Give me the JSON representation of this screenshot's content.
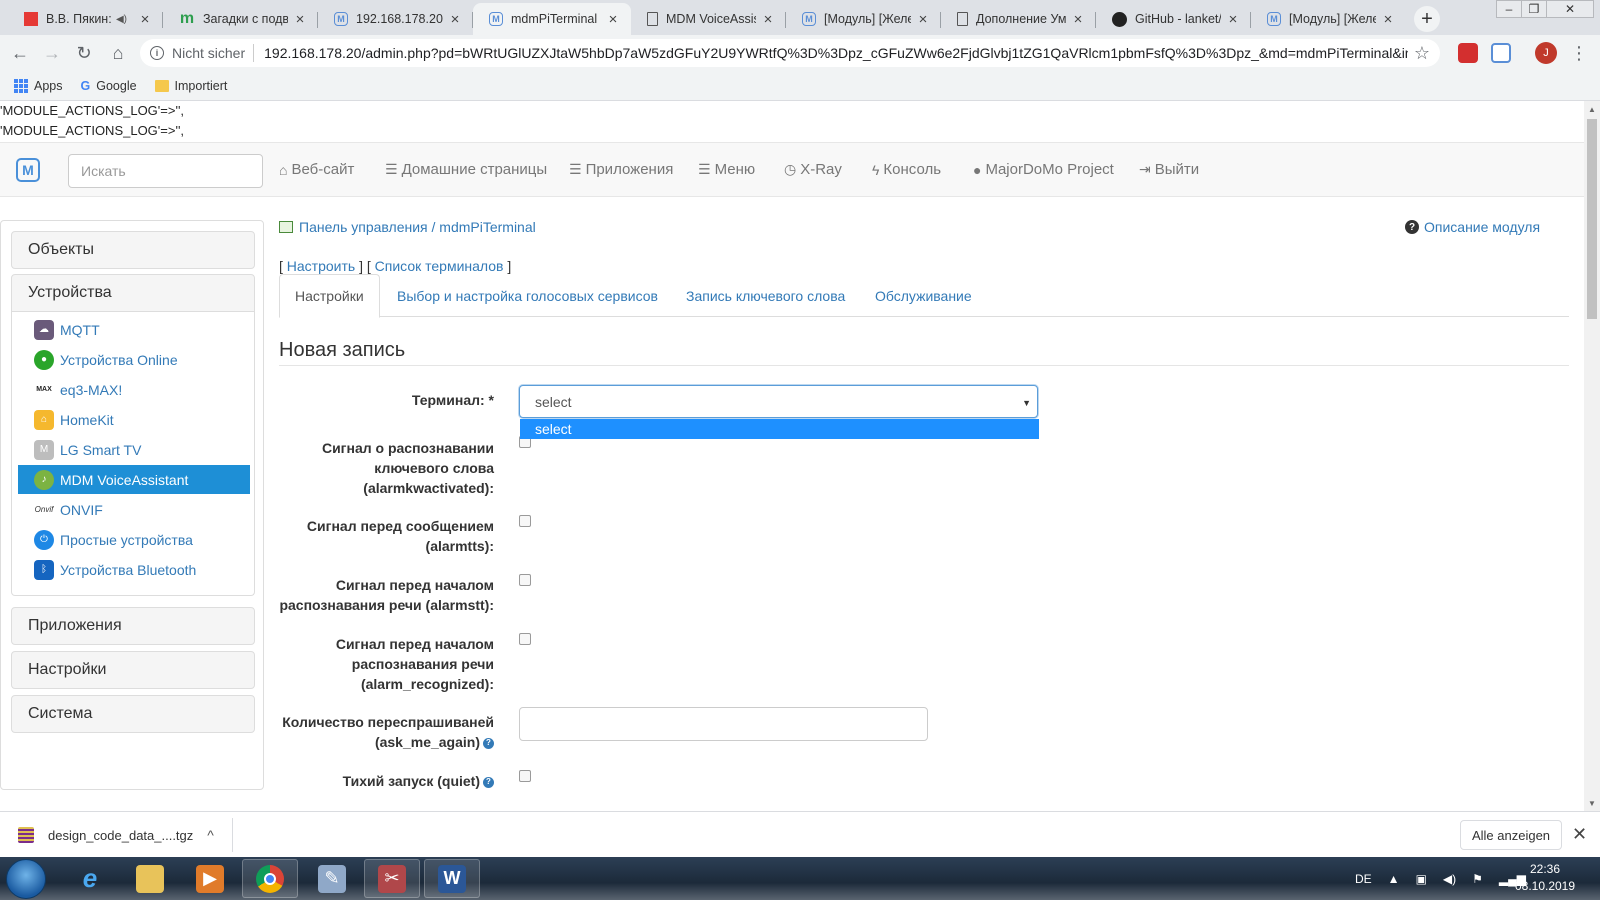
{
  "browser": {
    "tabs": [
      {
        "title": "В.В. Пякин: В",
        "icon": "red-square-icon"
      },
      {
        "title": "Загадки с подво",
        "icon": "mi-icon"
      },
      {
        "title": "192.168.178.20",
        "icon": "majordomo-icon"
      },
      {
        "title": "mdmPiTerminal",
        "icon": "majordomo-icon",
        "active": true
      },
      {
        "title": "MDM VoiceAssis",
        "icon": "document-icon"
      },
      {
        "title": "[Модуль] [Желе",
        "icon": "majordomo-icon"
      },
      {
        "title": "Дополнение Ум",
        "icon": "document-icon"
      },
      {
        "title": "GitHub - lanket/",
        "icon": "github-icon"
      },
      {
        "title": "[Модуль] [Желе",
        "icon": "majordomo-icon"
      }
    ],
    "security_label": "Nicht sicher",
    "url": "192.168.178.20/admin.php?pd=bWRtUGlUZXJtaW5hbDp7aW5zdGFuY2U9YWRtfQ%3D%3Dpz_cGFuZWw6e2FjdGlvbj1tZG1QaVRlcm1pbmFsfQ%3D%3Dpz_&md=mdmPiTerminal&inst...",
    "bookmarks": [
      {
        "label": "Apps",
        "icon": "apps-grid-icon"
      },
      {
        "label": "Google",
        "icon": "google-icon"
      },
      {
        "label": "Importiert",
        "icon": "folder-icon"
      }
    ]
  },
  "debug_lines": [
    "'MODULE_ACTIONS_LOG'=>'',",
    "'MODULE_ACTIONS_LOG'=>'',"
  ],
  "navbar": {
    "search_placeholder": "Искать",
    "links": [
      {
        "label": "Веб-сайт",
        "icon": "home-icon"
      },
      {
        "label": "Домашние страницы",
        "icon": "list-icon"
      },
      {
        "label": "Приложения",
        "icon": "list-icon"
      },
      {
        "label": "Меню",
        "icon": "list-icon"
      },
      {
        "label": "X-Ray",
        "icon": "clock-icon"
      },
      {
        "label": "Консоль",
        "icon": "bolt-icon"
      },
      {
        "label": "MajorDoMo Project",
        "icon": "globe-icon"
      },
      {
        "label": "Выйти",
        "icon": "sign-out-icon"
      }
    ]
  },
  "sidebar": {
    "sections": [
      "Объекты",
      "Устройства",
      "Приложения",
      "Настройки",
      "Система"
    ],
    "devices": [
      {
        "label": "MQTT",
        "icon": "mqtt-icon"
      },
      {
        "label": "Устройства Online",
        "icon": "online-icon"
      },
      {
        "label": "eq3-MAX!",
        "icon": "eq3-max-icon"
      },
      {
        "label": "HomeKit",
        "icon": "homekit-icon"
      },
      {
        "label": "LG Smart TV",
        "icon": "lg-tv-icon"
      },
      {
        "label": "MDM VoiceAssistant",
        "icon": "voice-assistant-icon",
        "active": true
      },
      {
        "label": "ONVIF",
        "icon": "onvif-icon"
      },
      {
        "label": "Простые устройства",
        "icon": "power-icon"
      },
      {
        "label": "Устройства Bluetooth",
        "icon": "bluetooth-icon"
      }
    ]
  },
  "main": {
    "breadcrumb": "Панель управления / mdmPiTerminal",
    "help_link": "Описание модуля",
    "actions": {
      "configure": "Настроить",
      "terminals": "Список терминалов"
    },
    "tabs": [
      "Настройки",
      "Выбор и настройка голосовых сервисов",
      "Запись ключевого слова",
      "Обслуживание"
    ],
    "form_title": "Новая запись",
    "terminal_label": "Терминал: *",
    "terminal_value": "select",
    "terminal_options": [
      "select"
    ],
    "fields": [
      "Сигнал о распознавании ключевого слова (alarmkwactivated):",
      "Сигнал перед сообщением (alarmtts):",
      "Сигнал перед началом распознавания речи (alarmstt):",
      "Сигнал перед началом распознавания речи (alarm_recognized):",
      "Количество переспрашиваней (ask_me_again)",
      "Тихий запуск (quiet)"
    ]
  },
  "download": {
    "filename": "design_code_data_....tgz",
    "show_all": "Alle anzeigen"
  },
  "taskbar": {
    "lang": "DE",
    "time": "22:36",
    "date": "08.10.2019"
  },
  "colors": {
    "link": "#337ab7",
    "active_item": "#1e8fd6",
    "dropdown_highlight": "#1e90ff"
  }
}
